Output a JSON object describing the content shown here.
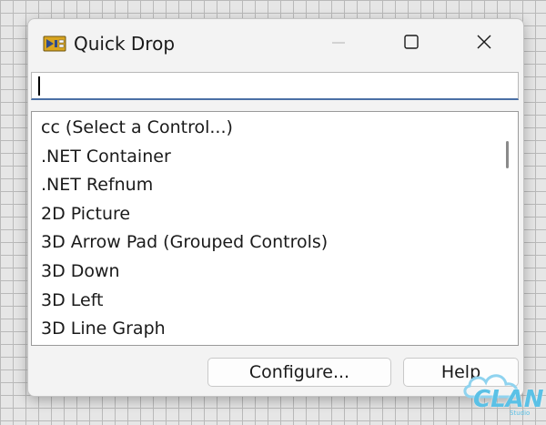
{
  "window": {
    "title": "Quick Drop"
  },
  "search": {
    "value": "",
    "placeholder": ""
  },
  "list": {
    "items": [
      "cc (Select a Control...)",
      ".NET Container",
      ".NET Refnum",
      "2D Picture",
      "3D Arrow Pad (Grouped Controls)",
      "3D Down",
      "3D Left",
      "3D Line Graph"
    ]
  },
  "buttons": {
    "configure": "Configure...",
    "help": "Help"
  },
  "watermark": {
    "text": "CLAN",
    "sub": "Studio"
  },
  "colors": {
    "accent": "#4a6fa5",
    "watermark": "#5bc1e6"
  },
  "icons": {
    "app": "labview-quick-drop-icon",
    "minimize": "minimize-icon",
    "maximize": "maximize-icon",
    "close": "close-icon"
  }
}
